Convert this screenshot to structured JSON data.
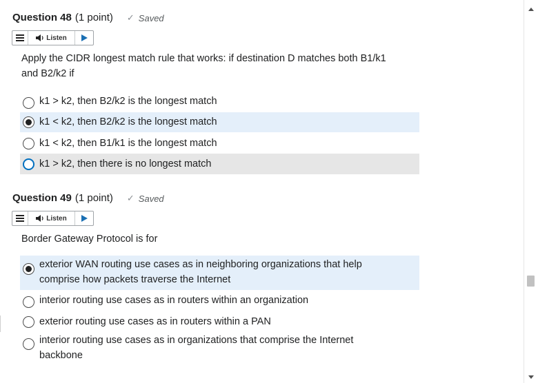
{
  "questions": [
    {
      "title": "Question 48",
      "points": "(1 point)",
      "status": "Saved",
      "listen_label": "Listen",
      "prompt_lines": [
        "Apply the CIDR longest match rule that works: if destination D matches both B1/k1",
        "and B2/k2 if"
      ],
      "options": [
        {
          "lines": [
            "k1 > k2, then B2/k2 is the longest match"
          ],
          "selected": false
        },
        {
          "lines": [
            "k1 < k2, then B2/k2 is the longest match"
          ],
          "selected": true
        },
        {
          "lines": [
            "k1 < k2, then B1/k1 is the longest match"
          ],
          "selected": false
        },
        {
          "lines": [
            "k1 > k2, then there is no longest match"
          ],
          "selected": false
        }
      ]
    },
    {
      "title": "Question 49",
      "points": "(1 point)",
      "status": "Saved",
      "listen_label": "Listen",
      "prompt_lines": [
        "Border Gateway Protocol is for"
      ],
      "options": [
        {
          "lines": [
            "exterior WAN routing use cases as in neighboring organizations that help",
            "comprise how packets traverse the Internet"
          ],
          "selected": true
        },
        {
          "lines": [
            "interior routing use cases as in routers within an organization"
          ],
          "selected": false
        },
        {
          "lines": [
            "exterior routing use cases as in routers within a PAN"
          ],
          "selected": false
        },
        {
          "lines": [
            "interior routing use cases as in organizations that comprise the Internet",
            "backbone"
          ],
          "selected": false
        }
      ]
    }
  ],
  "icons": {
    "saved": "check-icon",
    "menu": "menu-lines-icon",
    "speaker": "speaker-icon",
    "play": "play-icon",
    "radio": "radio-icon"
  },
  "colors": {
    "selected_bg": "#e4effa",
    "hover_bg": "#e6e6e6",
    "focus_ring": "#006fbf"
  }
}
